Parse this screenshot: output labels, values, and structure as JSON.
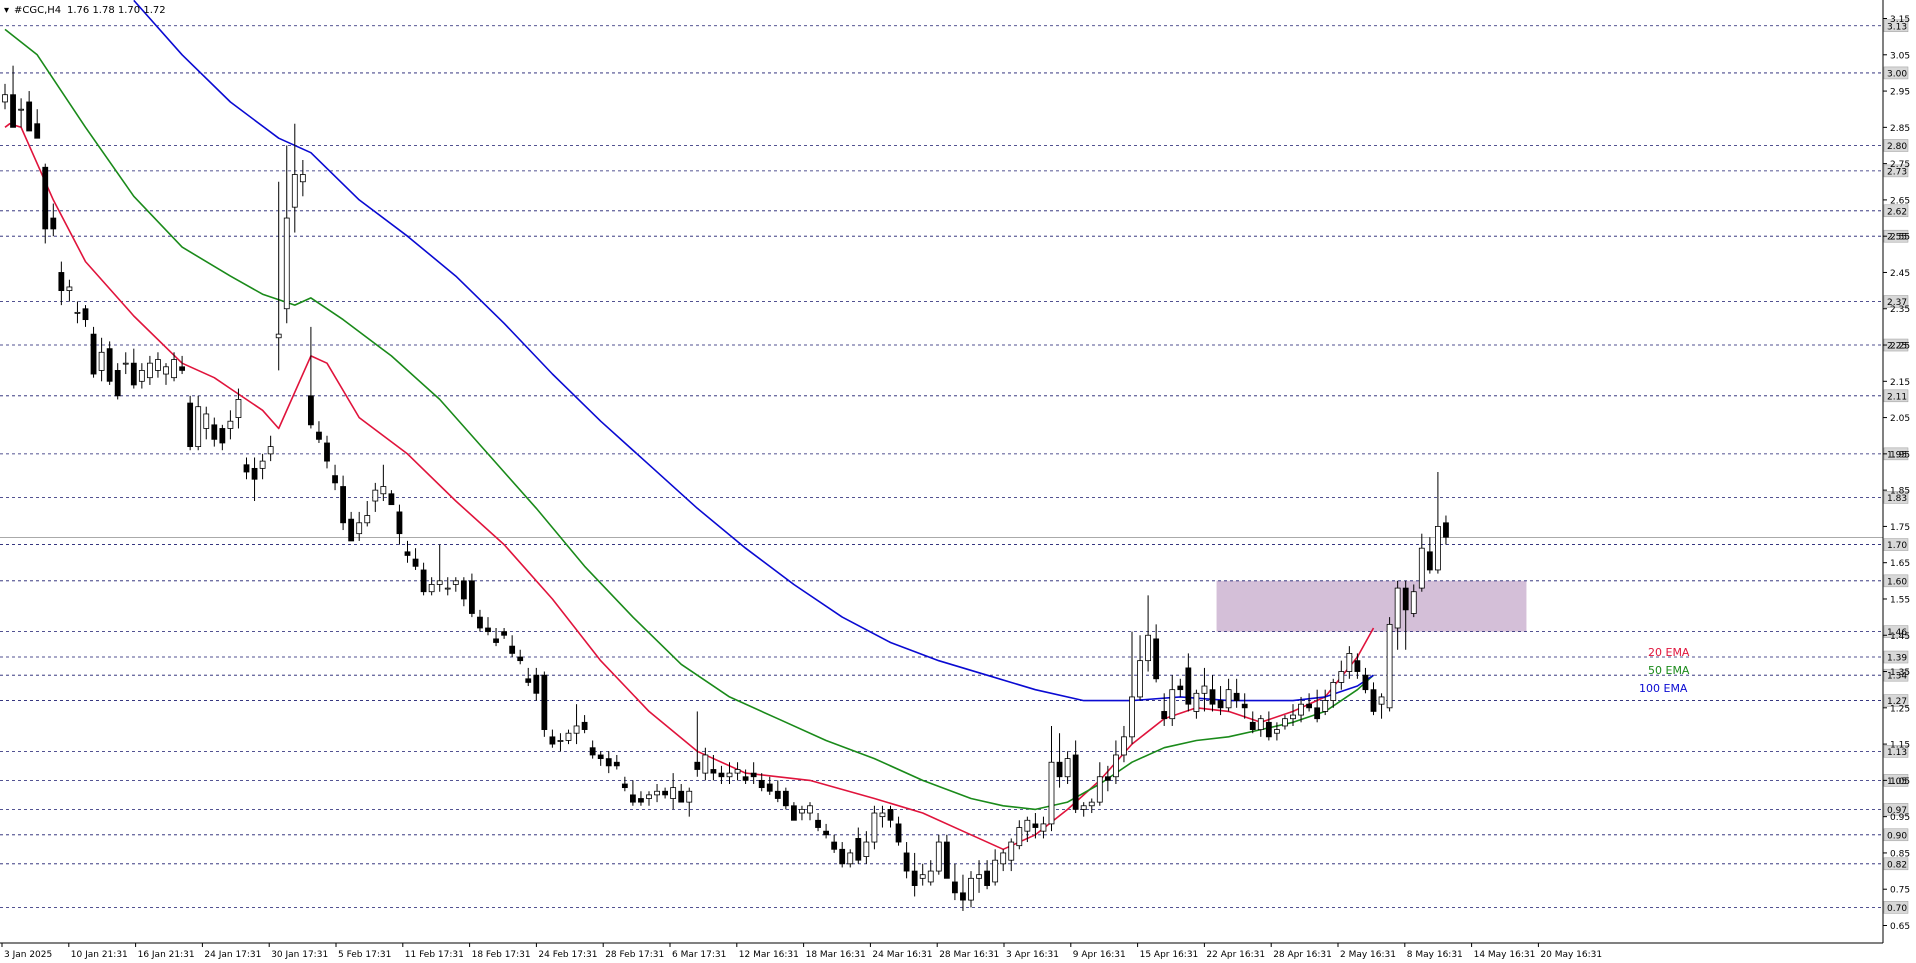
{
  "header": {
    "symbol": "#CGC,H4",
    "ohlc": "1.76 1.78 1.70 1.72"
  },
  "chart_data": {
    "type": "candlestick",
    "symbol": "#CGC",
    "timeframe": "H4",
    "ylim": [
      0.61,
      3.19
    ],
    "y_ticks": [
      3.15,
      3.05,
      2.95,
      2.85,
      2.75,
      2.65,
      2.55,
      2.45,
      2.35,
      2.25,
      2.15,
      2.05,
      1.95,
      1.85,
      1.75,
      1.65,
      1.55,
      1.45,
      1.35,
      1.25,
      1.15,
      1.05,
      0.95,
      0.85,
      0.75,
      0.65
    ],
    "x_labels": [
      "3 Jan 2025",
      "10 Jan 21:31",
      "16 Jan 21:31",
      "24 Jan 17:31",
      "30 Jan 17:31",
      "5 Feb 17:31",
      "11 Feb 17:31",
      "18 Feb 17:31",
      "24 Feb 17:31",
      "28 Feb 17:31",
      "6 Mar 17:31",
      "12 Mar 16:31",
      "18 Mar 16:31",
      "24 Mar 16:31",
      "28 Mar 16:31",
      "3 Apr 16:31",
      "9 Apr 16:31",
      "15 Apr 16:31",
      "22 Apr 16:31",
      "28 Apr 16:31",
      "2 May 16:31",
      "8 May 16:31",
      "14 May 16:31",
      "20 May 16:31"
    ],
    "horizontal_levels": [
      "3.13",
      "3.00",
      "2.80",
      "2.73",
      "2.62",
      "2.55",
      "2.37",
      "2.25",
      "2.11",
      "1.95",
      "1.83",
      "1.70",
      "1.60",
      "1.46",
      "1.39",
      "1.34",
      "1.27",
      "1.13",
      "1.05",
      "0.97",
      "0.90",
      "0.82",
      "0.70"
    ],
    "current_price": "1.72",
    "zone": {
      "from": 1.46,
      "to": 1.6,
      "color": "#d4bfd8"
    },
    "ema_legend": [
      {
        "name": "20 EMA",
        "color": "#e0143c"
      },
      {
        "name": "50 EMA",
        "color": "#1a8a1a"
      },
      {
        "name": "100 EMA",
        "color": "#0a0ad2"
      }
    ],
    "ema20": [
      [
        0,
        2.85
      ],
      [
        0.3,
        2.86
      ],
      [
        1,
        2.85
      ],
      [
        3,
        2.65
      ],
      [
        5,
        2.48
      ],
      [
        8,
        2.33
      ],
      [
        11,
        2.2
      ],
      [
        13,
        2.16
      ],
      [
        14,
        2.13
      ],
      [
        16,
        2.07
      ],
      [
        17,
        2.02
      ],
      [
        19,
        2.22
      ],
      [
        20,
        2.2
      ],
      [
        22,
        2.05
      ],
      [
        25,
        1.95
      ],
      [
        28,
        1.82
      ],
      [
        31,
        1.7
      ],
      [
        34,
        1.55
      ],
      [
        37,
        1.38
      ],
      [
        40,
        1.24
      ],
      [
        43,
        1.13
      ],
      [
        46,
        1.07
      ],
      [
        50,
        1.05
      ],
      [
        54,
        1.0
      ],
      [
        57,
        0.96
      ],
      [
        60,
        0.9
      ],
      [
        62,
        0.86
      ],
      [
        64,
        0.9
      ],
      [
        66,
        0.97
      ],
      [
        68,
        1.05
      ],
      [
        70,
        1.15
      ],
      [
        72,
        1.22
      ],
      [
        74,
        1.25
      ],
      [
        76,
        1.24
      ],
      [
        78,
        1.21
      ],
      [
        80,
        1.24
      ],
      [
        82,
        1.28
      ],
      [
        84,
        1.39
      ],
      [
        85,
        1.47
      ]
    ],
    "ema50": [
      [
        0,
        3.12
      ],
      [
        2,
        3.05
      ],
      [
        5,
        2.85
      ],
      [
        8,
        2.66
      ],
      [
        11,
        2.52
      ],
      [
        14,
        2.44
      ],
      [
        16,
        2.39
      ],
      [
        18,
        2.36
      ],
      [
        19,
        2.38
      ],
      [
        21,
        2.32
      ],
      [
        24,
        2.22
      ],
      [
        27,
        2.1
      ],
      [
        30,
        1.95
      ],
      [
        33,
        1.8
      ],
      [
        36,
        1.64
      ],
      [
        39,
        1.5
      ],
      [
        42,
        1.37
      ],
      [
        45,
        1.28
      ],
      [
        48,
        1.22
      ],
      [
        51,
        1.16
      ],
      [
        54,
        1.11
      ],
      [
        57,
        1.05
      ],
      [
        60,
        1.0
      ],
      [
        62,
        0.98
      ],
      [
        64,
        0.97
      ],
      [
        66,
        0.99
      ],
      [
        68,
        1.04
      ],
      [
        70,
        1.1
      ],
      [
        72,
        1.14
      ],
      [
        74,
        1.16
      ],
      [
        76,
        1.17
      ],
      [
        78,
        1.19
      ],
      [
        80,
        1.21
      ],
      [
        82,
        1.24
      ],
      [
        84,
        1.3
      ],
      [
        85,
        1.34
      ]
    ],
    "ema100": [
      [
        8,
        3.2
      ],
      [
        11,
        3.05
      ],
      [
        14,
        2.92
      ],
      [
        17,
        2.82
      ],
      [
        19,
        2.78
      ],
      [
        22,
        2.65
      ],
      [
        25,
        2.55
      ],
      [
        28,
        2.44
      ],
      [
        31,
        2.31
      ],
      [
        34,
        2.17
      ],
      [
        37,
        2.04
      ],
      [
        40,
        1.92
      ],
      [
        43,
        1.8
      ],
      [
        46,
        1.69
      ],
      [
        49,
        1.59
      ],
      [
        52,
        1.5
      ],
      [
        55,
        1.43
      ],
      [
        58,
        1.38
      ],
      [
        61,
        1.34
      ],
      [
        64,
        1.3
      ],
      [
        67,
        1.27
      ],
      [
        70,
        1.27
      ],
      [
        73,
        1.28
      ],
      [
        76,
        1.27
      ],
      [
        78,
        1.27
      ],
      [
        80,
        1.27
      ],
      [
        82,
        1.28
      ],
      [
        84,
        1.31
      ],
      [
        85,
        1.34
      ]
    ],
    "candles": [
      [
        2.92,
        2.97,
        2.9,
        2.94
      ],
      [
        2.94,
        3.02,
        2.86,
        2.85
      ],
      [
        2.9,
        2.93,
        2.85,
        2.9
      ],
      [
        2.92,
        2.95,
        2.85,
        2.84
      ],
      [
        2.86,
        2.9,
        2.82,
        2.82
      ],
      [
        2.74,
        2.75,
        2.53,
        2.57
      ],
      [
        2.6,
        2.64,
        2.55,
        2.57
      ],
      [
        2.45,
        2.48,
        2.36,
        2.4
      ],
      [
        2.4,
        2.43,
        2.37,
        2.41
      ],
      [
        2.34,
        2.37,
        2.31,
        2.34
      ],
      [
        2.35,
        2.36,
        2.3,
        2.32
      ],
      [
        2.28,
        2.3,
        2.16,
        2.17
      ],
      [
        2.18,
        2.27,
        2.15,
        2.23
      ],
      [
        2.24,
        2.26,
        2.14,
        2.15
      ],
      [
        2.18,
        2.2,
        2.1,
        2.11
      ],
      [
        2.2,
        2.23,
        2.17,
        2.2
      ],
      [
        2.2,
        2.24,
        2.13,
        2.14
      ],
      [
        2.15,
        2.2,
        2.13,
        2.18
      ],
      [
        2.16,
        2.22,
        2.14,
        2.2
      ],
      [
        2.18,
        2.23,
        2.16,
        2.21
      ],
      [
        2.17,
        2.2,
        2.14,
        2.19
      ],
      [
        2.16,
        2.23,
        2.15,
        2.21
      ],
      [
        2.19,
        2.22,
        2.17,
        2.18
      ],
      [
        2.09,
        2.11,
        1.96,
        1.97
      ],
      [
        1.97,
        2.11,
        1.96,
        2.08
      ],
      [
        2.02,
        2.08,
        1.99,
        2.06
      ],
      [
        2.03,
        2.05,
        1.97,
        1.99
      ],
      [
        2.02,
        2.03,
        1.96,
        1.98
      ],
      [
        2.02,
        2.07,
        1.99,
        2.04
      ],
      [
        2.05,
        2.13,
        2.02,
        2.1
      ],
      [
        1.92,
        1.94,
        1.88,
        1.9
      ],
      [
        1.91,
        1.94,
        1.82,
        1.88
      ],
      [
        1.91,
        1.95,
        1.88,
        1.93
      ],
      [
        1.95,
        2.0,
        1.93,
        1.97
      ],
      [
        2.27,
        2.7,
        2.18,
        2.28
      ],
      [
        2.35,
        2.8,
        2.31,
        2.6
      ],
      [
        2.63,
        2.86,
        2.56,
        2.72
      ],
      [
        2.7,
        2.76,
        2.66,
        2.72
      ],
      [
        2.11,
        2.3,
        2.02,
        2.03
      ],
      [
        2.01,
        2.04,
        1.98,
        1.99
      ],
      [
        1.98,
        2.0,
        1.91,
        1.93
      ],
      [
        1.89,
        1.92,
        1.85,
        1.87
      ],
      [
        1.86,
        1.89,
        1.74,
        1.76
      ],
      [
        1.77,
        1.79,
        1.71,
        1.71
      ],
      [
        1.73,
        1.79,
        1.71,
        1.76
      ],
      [
        1.76,
        1.82,
        1.75,
        1.78
      ],
      [
        1.82,
        1.87,
        1.79,
        1.85
      ],
      [
        1.84,
        1.92,
        1.82,
        1.86
      ],
      [
        1.84,
        1.85,
        1.81,
        1.81
      ],
      [
        1.79,
        1.81,
        1.7,
        1.73
      ],
      [
        1.68,
        1.71,
        1.65,
        1.67
      ],
      [
        1.66,
        1.69,
        1.63,
        1.64
      ],
      [
        1.63,
        1.65,
        1.56,
        1.57
      ],
      [
        1.57,
        1.61,
        1.56,
        1.59
      ],
      [
        1.59,
        1.7,
        1.57,
        1.6
      ],
      [
        1.58,
        1.61,
        1.56,
        1.58
      ],
      [
        1.59,
        1.61,
        1.57,
        1.6
      ],
      [
        1.6,
        1.61,
        1.53,
        1.55
      ],
      [
        1.6,
        1.62,
        1.5,
        1.51
      ],
      [
        1.5,
        1.52,
        1.46,
        1.47
      ],
      [
        1.47,
        1.5,
        1.45,
        1.46
      ],
      [
        1.44,
        1.47,
        1.42,
        1.43
      ],
      [
        1.46,
        1.47,
        1.44,
        1.45
      ],
      [
        1.42,
        1.45,
        1.39,
        1.4
      ],
      [
        1.39,
        1.41,
        1.37,
        1.38
      ],
      [
        1.33,
        1.36,
        1.31,
        1.32
      ],
      [
        1.34,
        1.36,
        1.27,
        1.29
      ],
      [
        1.34,
        1.35,
        1.17,
        1.19
      ],
      [
        1.17,
        1.19,
        1.14,
        1.15
      ],
      [
        1.16,
        1.18,
        1.13,
        1.16
      ],
      [
        1.16,
        1.19,
        1.15,
        1.18
      ],
      [
        1.18,
        1.26,
        1.15,
        1.2
      ],
      [
        1.21,
        1.23,
        1.18,
        1.19
      ],
      [
        1.14,
        1.16,
        1.11,
        1.12
      ],
      [
        1.12,
        1.13,
        1.09,
        1.11
      ],
      [
        1.11,
        1.13,
        1.07,
        1.09
      ],
      [
        1.1,
        1.12,
        1.08,
        1.09
      ],
      [
        1.04,
        1.06,
        1.02,
        1.03
      ],
      [
        1.01,
        1.05,
        0.98,
        0.99
      ],
      [
        1.0,
        1.02,
        0.98,
        0.99
      ],
      [
        1.0,
        1.02,
        0.98,
        1.01
      ],
      [
        1.01,
        1.04,
        0.99,
        1.02
      ],
      [
        1.02,
        1.03,
        1.0,
        1.01
      ],
      [
        1.0,
        1.07,
        0.97,
        1.03
      ],
      [
        1.02,
        1.04,
        0.99,
        0.99
      ],
      [
        0.99,
        1.03,
        0.95,
        1.02
      ],
      [
        1.1,
        1.24,
        1.06,
        1.08
      ],
      [
        1.07,
        1.14,
        1.05,
        1.12
      ],
      [
        1.08,
        1.12,
        1.05,
        1.07
      ],
      [
        1.07,
        1.09,
        1.04,
        1.06
      ],
      [
        1.06,
        1.1,
        1.04,
        1.07
      ],
      [
        1.07,
        1.1,
        1.05,
        1.08
      ],
      [
        1.06,
        1.08,
        1.04,
        1.05
      ],
      [
        1.07,
        1.1,
        1.04,
        1.06
      ],
      [
        1.05,
        1.07,
        1.02,
        1.03
      ],
      [
        1.04,
        1.06,
        1.01,
        1.02
      ],
      [
        1.02,
        1.05,
        0.99,
        1.0
      ],
      [
        1.02,
        1.03,
        0.97,
        0.98
      ],
      [
        0.98,
        0.99,
        0.94,
        0.94
      ],
      [
        0.96,
        0.98,
        0.94,
        0.97
      ],
      [
        0.96,
        0.99,
        0.94,
        0.98
      ],
      [
        0.94,
        0.96,
        0.91,
        0.92
      ],
      [
        0.91,
        0.93,
        0.89,
        0.9
      ],
      [
        0.88,
        0.9,
        0.85,
        0.86
      ],
      [
        0.86,
        0.88,
        0.81,
        0.82
      ],
      [
        0.82,
        0.86,
        0.81,
        0.85
      ],
      [
        0.89,
        0.92,
        0.82,
        0.83
      ],
      [
        0.84,
        0.91,
        0.82,
        0.88
      ],
      [
        0.88,
        0.98,
        0.86,
        0.96
      ],
      [
        0.95,
        0.98,
        0.92,
        0.96
      ],
      [
        0.97,
        0.98,
        0.92,
        0.94
      ],
      [
        0.93,
        0.95,
        0.87,
        0.88
      ],
      [
        0.85,
        0.88,
        0.78,
        0.8
      ],
      [
        0.8,
        0.85,
        0.73,
        0.76
      ],
      [
        0.78,
        0.82,
        0.76,
        0.79
      ],
      [
        0.77,
        0.83,
        0.76,
        0.8
      ],
      [
        0.8,
        0.9,
        0.79,
        0.88
      ],
      [
        0.88,
        0.9,
        0.78,
        0.78
      ],
      [
        0.77,
        0.82,
        0.72,
        0.74
      ],
      [
        0.74,
        0.79,
        0.69,
        0.72
      ],
      [
        0.72,
        0.8,
        0.7,
        0.78
      ],
      [
        0.78,
        0.83,
        0.74,
        0.79
      ],
      [
        0.8,
        0.83,
        0.75,
        0.76
      ],
      [
        0.77,
        0.86,
        0.76,
        0.83
      ],
      [
        0.82,
        0.86,
        0.8,
        0.85
      ],
      [
        0.83,
        0.89,
        0.8,
        0.88
      ],
      [
        0.87,
        0.94,
        0.86,
        0.92
      ],
      [
        0.91,
        0.95,
        0.88,
        0.94
      ],
      [
        0.93,
        0.96,
        0.89,
        0.92
      ],
      [
        0.91,
        0.95,
        0.89,
        0.93
      ],
      [
        0.93,
        1.2,
        0.91,
        1.1
      ],
      [
        1.1,
        1.18,
        1.03,
        1.06
      ],
      [
        1.06,
        1.13,
        1.04,
        1.11
      ],
      [
        1.12,
        1.16,
        0.96,
        0.97
      ],
      [
        0.97,
        0.99,
        0.95,
        0.98
      ],
      [
        0.98,
        1.0,
        0.96,
        0.99
      ],
      [
        0.99,
        1.1,
        0.98,
        1.06
      ],
      [
        1.06,
        1.09,
        1.02,
        1.05
      ],
      [
        1.06,
        1.16,
        1.04,
        1.12
      ],
      [
        1.12,
        1.2,
        1.1,
        1.17
      ],
      [
        1.17,
        1.46,
        1.15,
        1.28
      ],
      [
        1.28,
        1.45,
        1.27,
        1.38
      ],
      [
        1.38,
        1.56,
        1.35,
        1.45
      ],
      [
        1.44,
        1.48,
        1.32,
        1.33
      ],
      [
        1.24,
        1.29,
        1.2,
        1.22
      ],
      [
        1.22,
        1.34,
        1.2,
        1.3
      ],
      [
        1.31,
        1.33,
        1.28,
        1.3
      ],
      [
        1.36,
        1.4,
        1.24,
        1.26
      ],
      [
        1.24,
        1.3,
        1.22,
        1.29
      ],
      [
        1.29,
        1.36,
        1.24,
        1.31
      ],
      [
        1.3,
        1.34,
        1.24,
        1.26
      ],
      [
        1.27,
        1.31,
        1.23,
        1.25
      ],
      [
        1.25,
        1.33,
        1.24,
        1.3
      ],
      [
        1.29,
        1.33,
        1.25,
        1.27
      ],
      [
        1.26,
        1.29,
        1.22,
        1.25
      ],
      [
        1.21,
        1.24,
        1.18,
        1.19
      ],
      [
        1.19,
        1.23,
        1.17,
        1.22
      ],
      [
        1.21,
        1.24,
        1.16,
        1.17
      ],
      [
        1.18,
        1.21,
        1.16,
        1.19
      ],
      [
        1.2,
        1.23,
        1.19,
        1.22
      ],
      [
        1.22,
        1.26,
        1.2,
        1.23
      ],
      [
        1.23,
        1.28,
        1.21,
        1.26
      ],
      [
        1.26,
        1.29,
        1.24,
        1.25
      ],
      [
        1.25,
        1.3,
        1.21,
        1.22
      ],
      [
        1.24,
        1.3,
        1.23,
        1.27
      ],
      [
        1.27,
        1.33,
        1.25,
        1.32
      ],
      [
        1.32,
        1.38,
        1.3,
        1.35
      ],
      [
        1.35,
        1.42,
        1.33,
        1.4
      ],
      [
        1.38,
        1.4,
        1.33,
        1.35
      ],
      [
        1.34,
        1.36,
        1.29,
        1.3
      ],
      [
        1.3,
        1.32,
        1.23,
        1.24
      ],
      [
        1.26,
        1.29,
        1.22,
        1.28
      ],
      [
        1.25,
        1.5,
        1.24,
        1.48
      ],
      [
        1.47,
        1.6,
        1.41,
        1.58
      ],
      [
        1.58,
        1.6,
        1.41,
        1.52
      ],
      [
        1.51,
        1.59,
        1.5,
        1.57
      ],
      [
        1.58,
        1.73,
        1.57,
        1.69
      ],
      [
        1.68,
        1.72,
        1.62,
        1.63
      ],
      [
        1.63,
        1.9,
        1.62,
        1.75
      ],
      [
        1.76,
        1.78,
        1.7,
        1.72
      ]
    ]
  }
}
